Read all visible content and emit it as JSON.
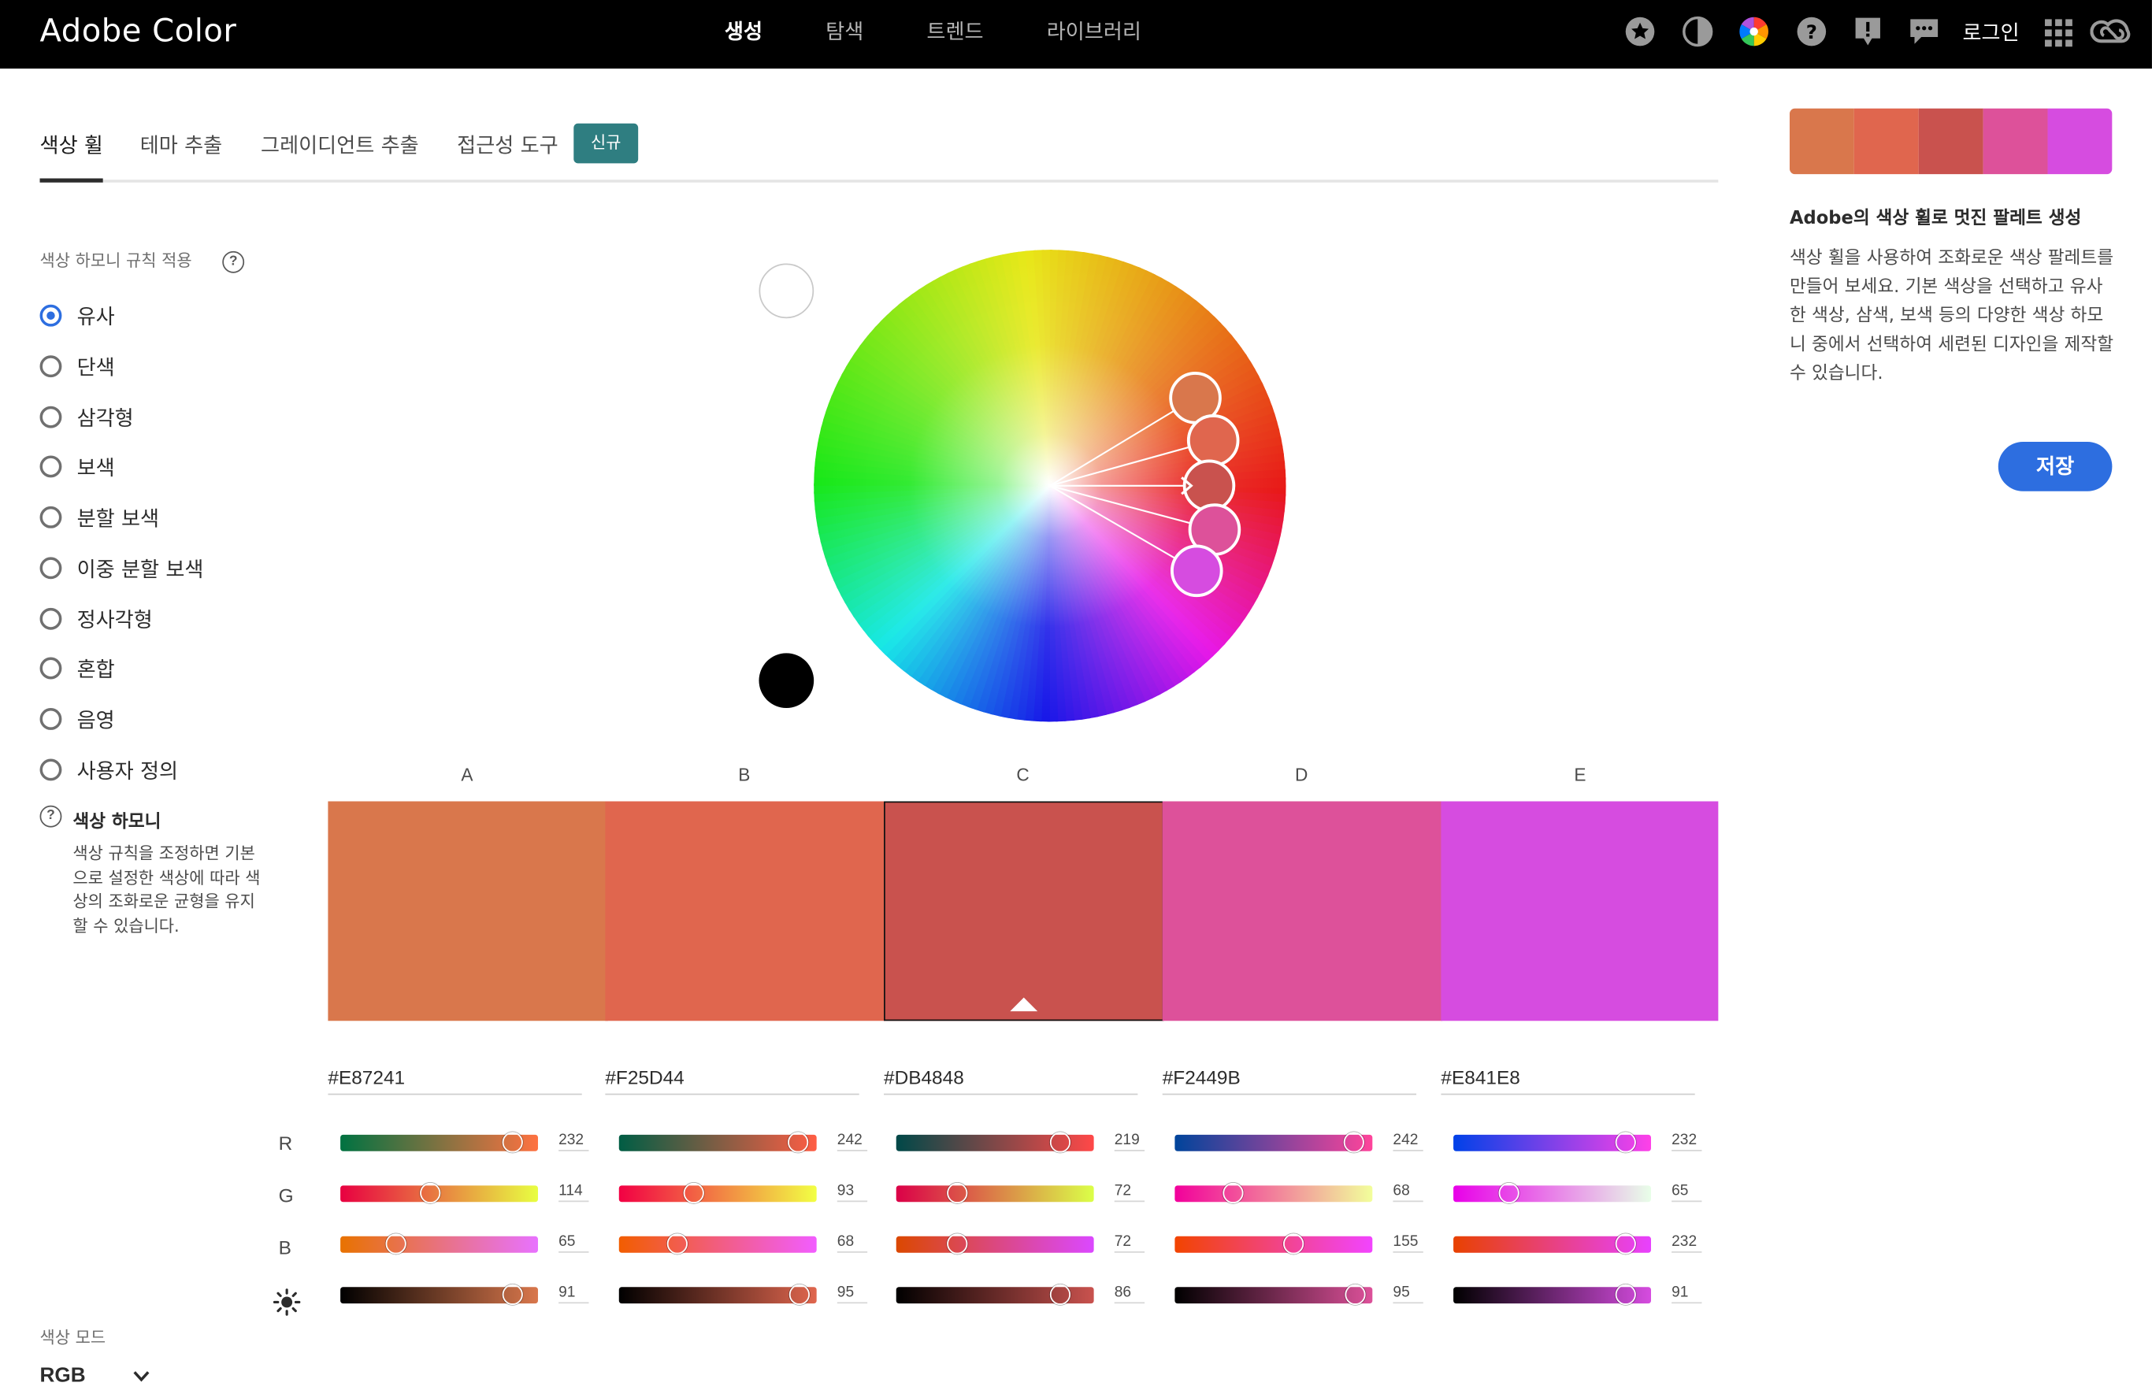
{
  "app": {
    "brand": "Adobe Color"
  },
  "topnav": [
    "생성",
    "탐색",
    "트렌드",
    "라이브러리"
  ],
  "topbar_icons": [
    "star-icon",
    "contrast-icon",
    "color-wheel-icon",
    "help-icon",
    "feedback-icon",
    "chat-icon",
    "apps-grid-icon",
    "creative-cloud-icon"
  ],
  "login_label": "로그인",
  "tabs": [
    "색상 휠",
    "테마 추출",
    "그레이디언트 추출",
    "접근성 도구"
  ],
  "new_badge": "신규",
  "harmony": {
    "title": "색상 하모니 규칙 적용",
    "options": [
      "유사",
      "단색",
      "삼각형",
      "보색",
      "분할 보색",
      "이중 분할 보색",
      "정사각형",
      "혼합",
      "음영",
      "사용자 정의"
    ],
    "selected": "유사",
    "info_title": "색상 하모니",
    "info_text": "색상 규칙을 조정하면 기본으로 설정한 색상에 따라 색상의 조화로운 균형을 유지할 수 있습니다."
  },
  "palette": {
    "labels": [
      "A",
      "B",
      "C",
      "D",
      "E"
    ],
    "selected_index": 2,
    "colors": [
      "#D9774C",
      "#E0664E",
      "#C9524E",
      "#DD519A",
      "#D64CE0"
    ],
    "hex": [
      "#E87241",
      "#F25D44",
      "#DB4848",
      "#F2449B",
      "#E841E8"
    ]
  },
  "channels": {
    "row_labels": [
      "R",
      "G",
      "B"
    ],
    "brightness_icon": "sun-icon",
    "r": [
      232,
      242,
      219,
      242,
      232
    ],
    "g": [
      114,
      93,
      72,
      68,
      65
    ],
    "b": [
      65,
      68,
      72,
      155,
      232
    ],
    "brightness": [
      91,
      95,
      86,
      95,
      91
    ]
  },
  "color_mode": {
    "label": "색상 모드",
    "value": "RGB"
  },
  "right_panel": {
    "title": "Adobe의 색상 휠로 멋진 팔레트 생성",
    "text": "색상 휠을 사용하여 조화로운 색상 팔레트를 만들어 보세요. 기본 색상을 선택하고 유사한 색상, 삼색, 보색 등의 다양한 색상 하모니 중에서 선택하여 세련된 디자인을 제작할 수 있습니다.",
    "save_label": "저장"
  }
}
